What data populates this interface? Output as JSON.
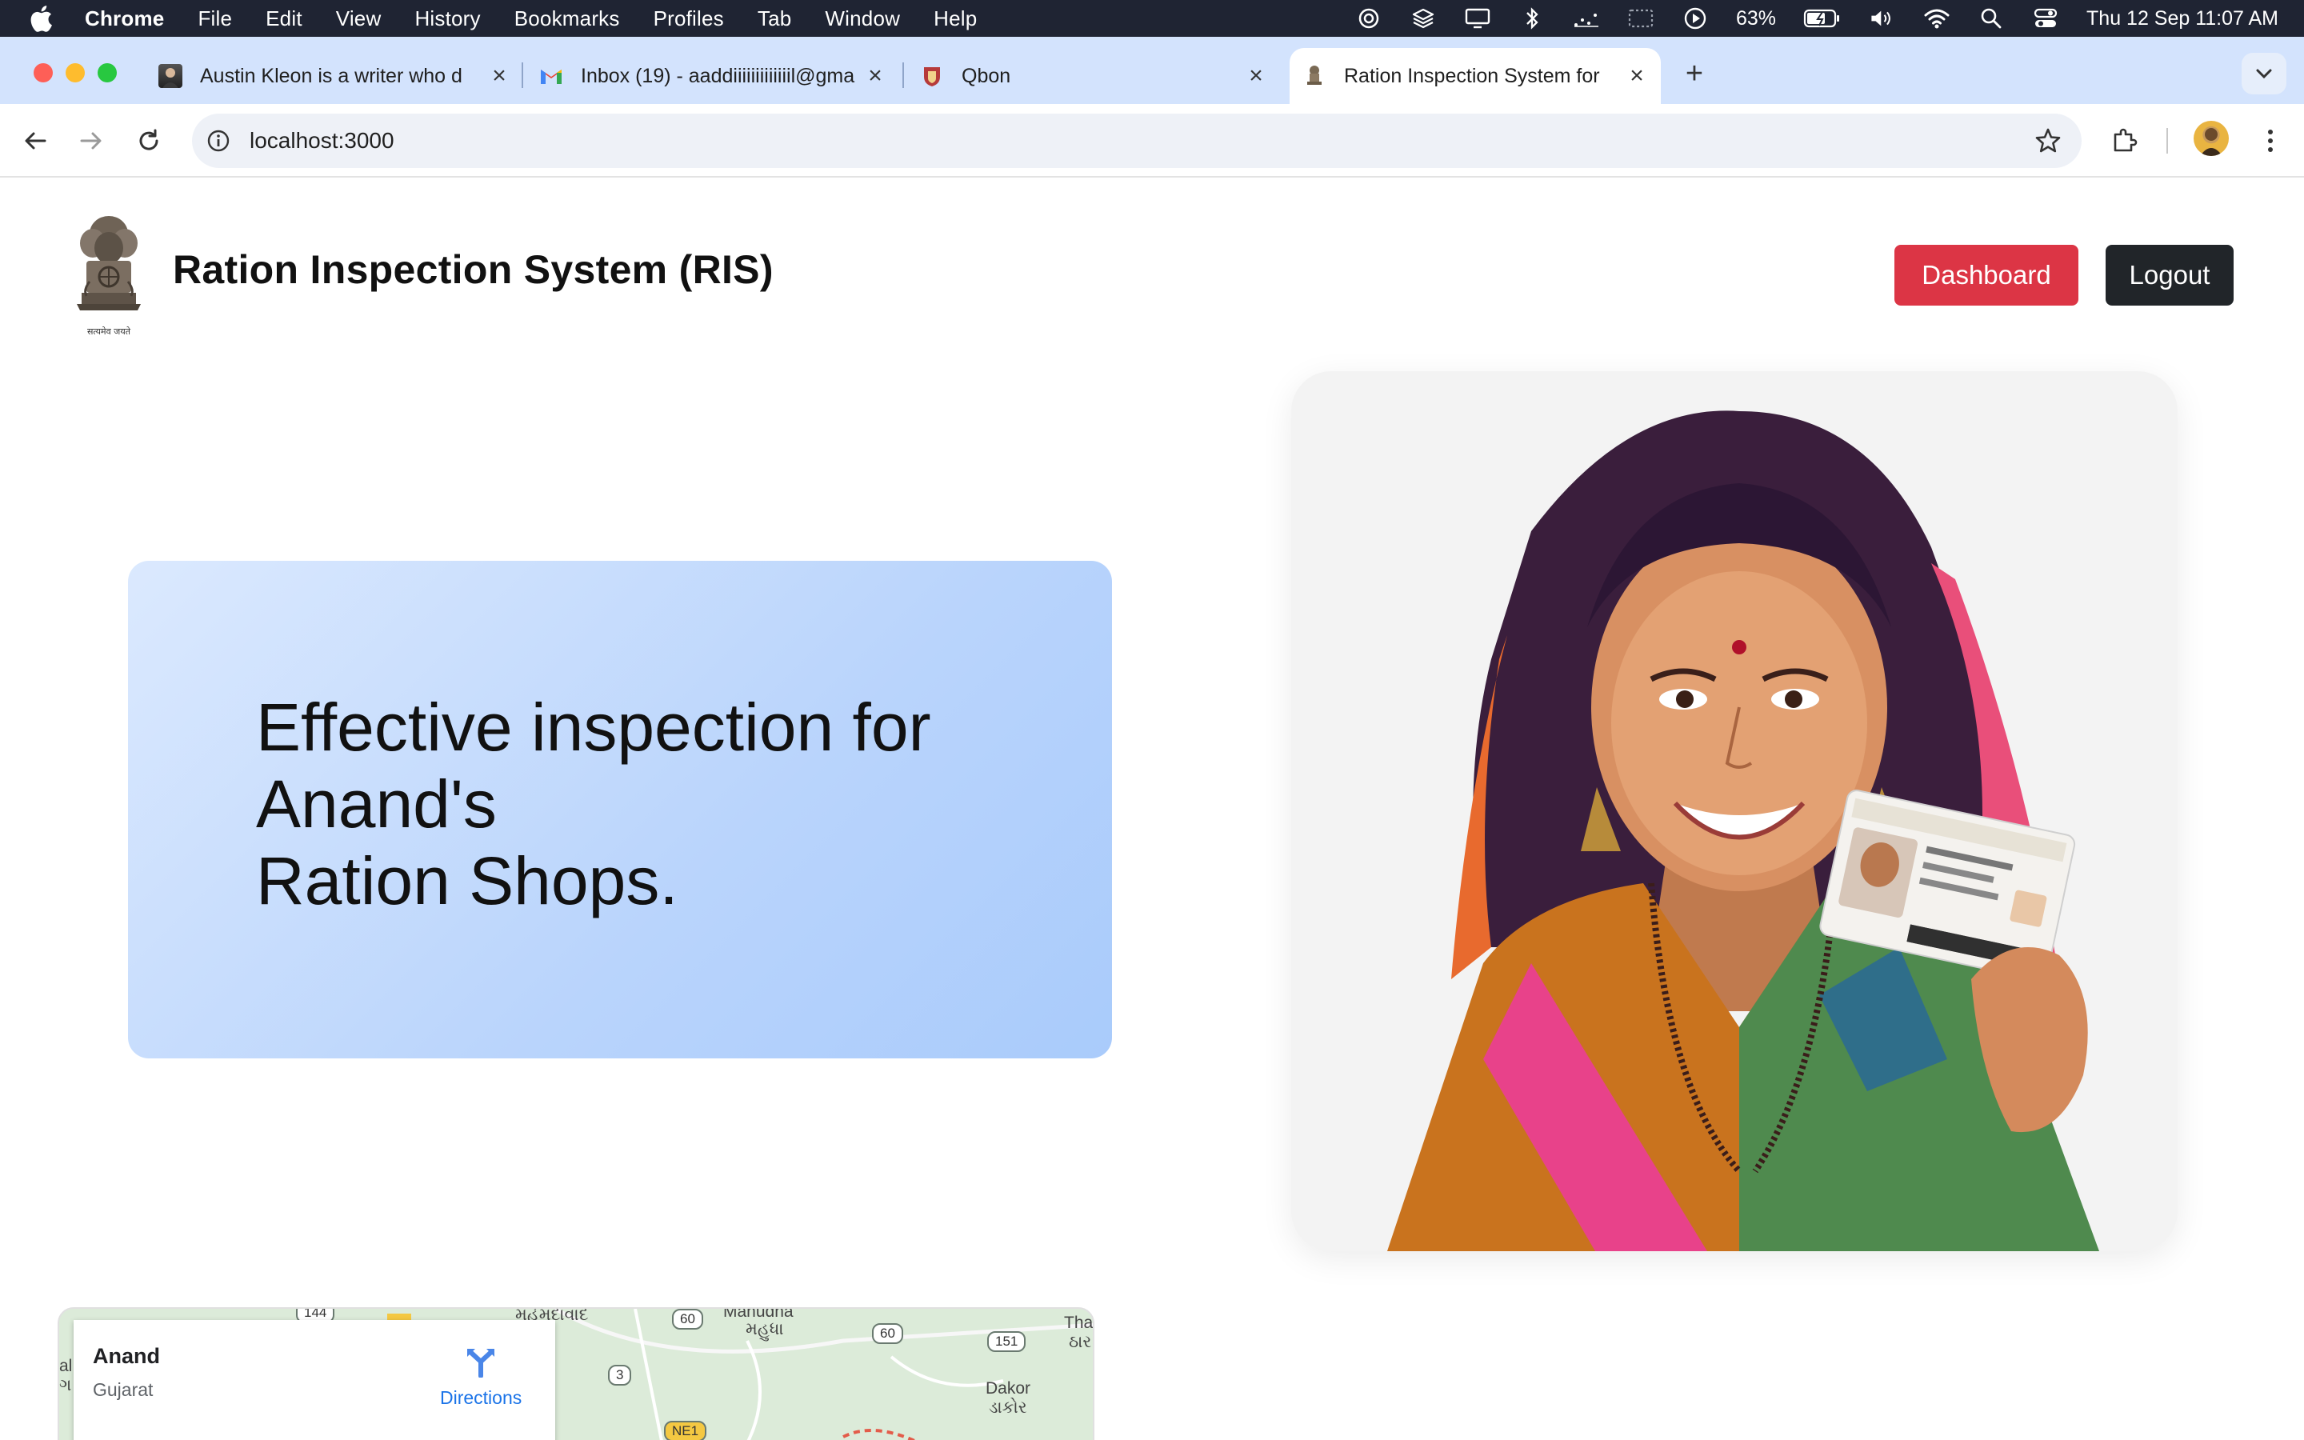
{
  "menubar": {
    "app_name": "Chrome",
    "items": [
      "File",
      "Edit",
      "View",
      "History",
      "Bookmarks",
      "Profiles",
      "Tab",
      "Window",
      "Help"
    ],
    "battery": "63%",
    "datetime": "Thu 12 Sep  11:07 AM"
  },
  "tabs": [
    {
      "title": "Austin Kleon is a writer who d",
      "favicon": "person-photo-icon"
    },
    {
      "title": "Inbox (19) - aaddiiiiiiiiiiiiil@gma",
      "favicon": "gmail-icon"
    },
    {
      "title": "Qbon",
      "favicon": "crest-icon"
    },
    {
      "title": "Ration Inspection System for",
      "favicon": "emblem-icon",
      "active": true
    }
  ],
  "toolbar": {
    "url": "localhost:3000"
  },
  "page": {
    "site_title": "Ration Inspection System (RIS)",
    "dashboard_label": "Dashboard",
    "logout_label": "Logout",
    "hero_line1": "Effective inspection for",
    "hero_line2": "Anand's",
    "hero_line3": "Ration Shops.",
    "emblem_motto": "सत्यमेव जयते",
    "map": {
      "place": "Anand",
      "region": "Gujarat",
      "directions_label": "Directions",
      "labels": [
        "મહેમદાવાદ",
        "Mahudha",
        "મહુધા",
        "Tha",
        "ઠાર",
        "Dakor",
        "ડાકોર",
        "al",
        "ગ"
      ],
      "road_shields": [
        "60",
        "60",
        "151",
        "3",
        "NE1",
        "144"
      ]
    }
  },
  "colors": {
    "menubar_bg": "#1f2433",
    "tabstrip_bg": "#d3e3fd",
    "dashboard_btn": "#dc3545",
    "logout_btn": "#212529",
    "hero_gradient_start": "#dbe9fe",
    "hero_gradient_end": "#a9cbfb",
    "map_link": "#1a73e8"
  }
}
